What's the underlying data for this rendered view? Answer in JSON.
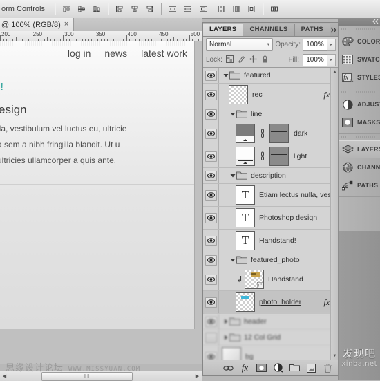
{
  "options_bar": {
    "label": "orm Controls",
    "groups": [
      {
        "name": "align-vertical",
        "icons": [
          "align-top-edges-icon",
          "align-vertical-centers-icon",
          "align-bottom-edges-icon"
        ]
      },
      {
        "name": "align-horizontal",
        "icons": [
          "align-left-edges-icon",
          "align-horizontal-centers-icon",
          "align-right-edges-icon"
        ]
      },
      {
        "name": "distribute-vertical",
        "icons": [
          "distribute-top-edges-icon",
          "distribute-vertical-centers-icon",
          "distribute-bottom-edges-icon"
        ]
      },
      {
        "name": "distribute-horizontal",
        "icons": [
          "distribute-left-edges-icon",
          "distribute-horizontal-centers-icon",
          "distribute-right-edges-icon"
        ]
      },
      {
        "name": "auto-align",
        "icons": [
          "auto-align-layers-icon"
        ]
      }
    ]
  },
  "document": {
    "tab_title": "@ 100% (RGB/8)",
    "close_glyph": "×"
  },
  "ruler": {
    "labels": [
      "200",
      "250",
      "300",
      "350",
      "400",
      "450",
      "500"
    ],
    "unit_start": 200,
    "unit_end": 520
  },
  "artboard": {
    "nav": [
      "log in",
      "news",
      "latest work"
    ],
    "exclamation": "!",
    "headline": "esign",
    "body": [
      "lla, vestibulum vel luctus eu, ultricie",
      "a sem a nibh fringilla blandit. Ut u",
      "ultricies ullamcorper a quis ante."
    ],
    "accent_color": "#3aa8a0"
  },
  "layers_panel": {
    "tabs": [
      {
        "label": "LAYERS",
        "active": true
      },
      {
        "label": "CHANNELS",
        "active": false
      },
      {
        "label": "PATHS",
        "active": false
      }
    ],
    "tab_controls": [
      "collapse-arrows-icon",
      "panel-menu-icon"
    ],
    "blend_mode": "Normal",
    "opacity_label": "Opacity:",
    "opacity_value": "100%",
    "lock_label": "Lock:",
    "lock_icons": [
      "lock-transparency-icon",
      "lock-image-icon",
      "lock-position-icon",
      "lock-all-icon"
    ],
    "fill_label": "Fill:",
    "fill_value": "100%",
    "rows": [
      {
        "name": "featured",
        "type": "group",
        "indent": 0,
        "expanded": true,
        "visible": true,
        "selected": false,
        "blurred": false
      },
      {
        "name": "rec",
        "type": "layer",
        "indent": 1,
        "visible": true,
        "selected": false,
        "thumb": "checker",
        "fx": true,
        "blurred": false
      },
      {
        "name": "line",
        "type": "group",
        "indent": 1,
        "expanded": true,
        "visible": true,
        "selected": false,
        "blurred": false
      },
      {
        "name": "dark",
        "type": "layer",
        "indent": 2,
        "visible": true,
        "selected": false,
        "thumb": "dark-swatch",
        "mask": true,
        "linked": true,
        "blurred": false
      },
      {
        "name": "light",
        "type": "layer",
        "indent": 2,
        "visible": true,
        "selected": false,
        "thumb": "light-swatch",
        "mask": true,
        "linked": true,
        "blurred": false
      },
      {
        "name": "description",
        "type": "group",
        "indent": 1,
        "expanded": true,
        "visible": true,
        "selected": false,
        "blurred": false
      },
      {
        "name": "Etiam lectus nulla, ves...",
        "type": "text",
        "indent": 2,
        "visible": true,
        "selected": false,
        "thumb": "T",
        "blurred": false
      },
      {
        "name": "Photoshop design",
        "type": "text",
        "indent": 2,
        "visible": true,
        "selected": false,
        "thumb": "T",
        "blurred": false
      },
      {
        "name": "Handstand!",
        "type": "text",
        "indent": 2,
        "visible": true,
        "selected": false,
        "thumb": "T",
        "blurred": false
      },
      {
        "name": "featured_photo",
        "type": "group",
        "indent": 1,
        "expanded": true,
        "visible": true,
        "selected": false,
        "blurred": false
      },
      {
        "name": "Handstand",
        "type": "layer",
        "indent": 2,
        "visible": true,
        "selected": false,
        "thumb": "photo",
        "clipped": true,
        "smart_object": true,
        "blurred": false
      },
      {
        "name": "photo_holder",
        "type": "layer",
        "indent": 2,
        "visible": true,
        "selected": true,
        "thumb": "checker",
        "fx": true,
        "underline": true,
        "blurred": false
      },
      {
        "name": "header",
        "type": "group",
        "indent": 0,
        "expanded": false,
        "visible": true,
        "selected": false,
        "blurred": true
      },
      {
        "name": "12 Col Grid",
        "type": "group",
        "indent": 0,
        "expanded": false,
        "visible": false,
        "selected": false,
        "blurred": true
      },
      {
        "name": "bg",
        "type": "layer",
        "indent": 0,
        "visible": true,
        "selected": false,
        "thumb": "bg",
        "blurred": true
      }
    ],
    "bottom_buttons": [
      "link-layers-icon",
      "add-layer-style-icon",
      "add-layer-mask-icon",
      "new-adjustment-layer-icon",
      "new-group-icon",
      "new-layer-icon",
      "delete-layer-icon"
    ]
  },
  "right_dock": {
    "groups": [
      {
        "items": [
          {
            "label": "COLOR",
            "icon": "color-palette-icon",
            "active": false
          },
          {
            "label": "SWATCHES",
            "icon": "swatches-grid-icon",
            "active": false
          },
          {
            "label": "STYLES",
            "icon": "styles-fx-icon",
            "active": false
          }
        ]
      },
      {
        "items": [
          {
            "label": "ADJUSTMENTS",
            "icon": "adjustments-circle-icon",
            "active": false
          },
          {
            "label": "MASKS",
            "icon": "masks-icon",
            "active": false
          }
        ]
      },
      {
        "items": [
          {
            "label": "LAYERS",
            "icon": "layers-stack-icon",
            "active": true
          },
          {
            "label": "CHANNELS",
            "icon": "channels-sphere-icon",
            "active": false
          },
          {
            "label": "PATHS",
            "icon": "paths-pen-icon",
            "active": false
          }
        ]
      }
    ]
  },
  "watermarks": {
    "left_cn": "思缘设计论坛",
    "left_url": "WWW.MISSYUAN.COM",
    "right_cn": "发现吧",
    "right_sub": "xinba.net"
  },
  "scrollbars": {
    "h_left_glyph": "◀",
    "h_right_glyph": "▶",
    "v_up_glyph": "▲",
    "v_down_glyph": "▼",
    "grip": "‖‖"
  }
}
